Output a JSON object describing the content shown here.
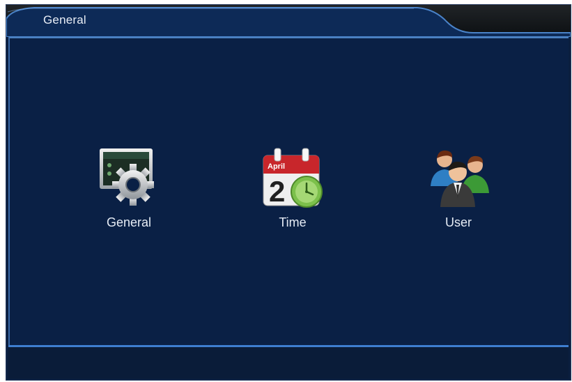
{
  "window": {
    "title": "General"
  },
  "menu": {
    "items": [
      {
        "label": "General",
        "icon": "monitor-gear-icon"
      },
      {
        "label": "Time",
        "icon": "calendar-clock-icon",
        "calendar_month": "April",
        "calendar_day": "2"
      },
      {
        "label": "User",
        "icon": "users-group-icon"
      }
    ]
  },
  "colors": {
    "background": "#0a2045",
    "accent_line": "#3e7ed0",
    "text": "#e6ecf5",
    "calendar_red": "#c8262b",
    "clock_green": "#7cc04b"
  }
}
